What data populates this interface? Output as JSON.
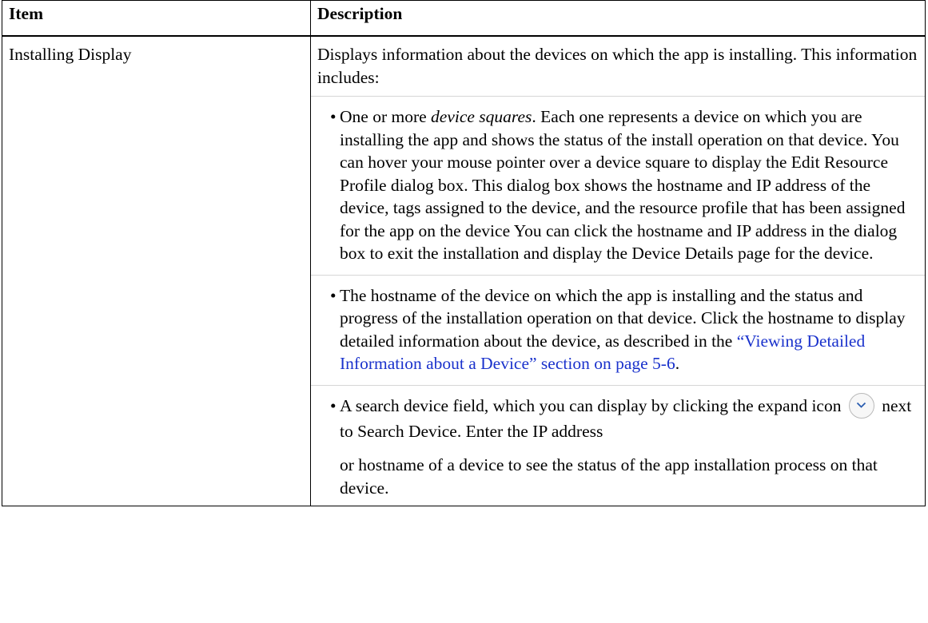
{
  "header": {
    "col_item": "Item",
    "col_description": "Description"
  },
  "row": {
    "item": "Installing Display",
    "intro": "Displays information about the devices on which the app is installing. This information includes:",
    "bullets": [
      {
        "em": "device squares",
        "pre": "One or more ",
        "post": ". Each one represents a device on which you are installing the app and shows the status of the install operation on that device. You can hover your mouse pointer over a device square to display the Edit Resource Profile dialog box. This dialog box shows the hostname and IP address of the device, tags assigned to the device, and the resource profile that has been assigned for the app on the device You can click the hostname and IP address in the dialog box to exit the installation and display the Device Details page for the device."
      },
      {
        "pre": "The hostname of the device on which the app is installing and the status and progress of the installation operation on that device. Click the hostname to display detailed information about the device, as described in the ",
        "link": "“Viewing Detailed Information about a Device” section on page 5-6",
        "post": "."
      },
      {
        "pre": "A search device field, which you can display by clicking the expand icon",
        "mid": "next to Search Device. Enter the IP address",
        "post": "or hostname of a device to see the status of the app installation process on that device."
      }
    ]
  },
  "icons": {
    "expand": "chevron-down-circle-icon"
  },
  "colors": {
    "link": "#1a32cc"
  }
}
